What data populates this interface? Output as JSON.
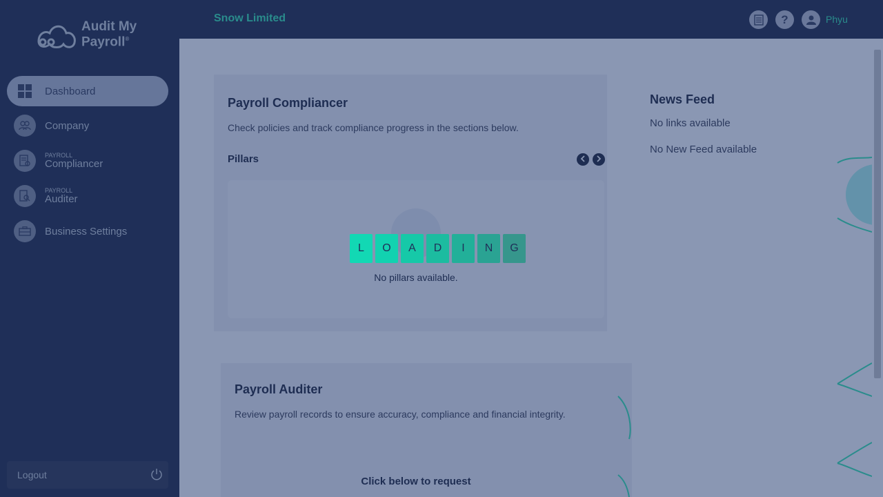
{
  "app": {
    "logo_line1": "Audit My",
    "logo_line2": "Payroll",
    "logo_mark": "®"
  },
  "sidebar": {
    "items": [
      {
        "label": "Dashboard",
        "icon": "dashboard-grid-icon",
        "active": true
      },
      {
        "label": "Company",
        "icon": "people-icon"
      },
      {
        "small": "PAYROLL",
        "label": "Compliancer",
        "icon": "compliance-document-icon"
      },
      {
        "small": "PAYROLL",
        "label": "Auditer",
        "icon": "audit-search-icon"
      },
      {
        "label": "Business Settings",
        "icon": "briefcase-icon"
      }
    ],
    "logout_label": "Logout"
  },
  "header": {
    "company": "Snow Limited",
    "user": "Phyu",
    "icons": [
      "report-icon",
      "help-icon",
      "user-avatar-icon"
    ],
    "help_glyph": "?"
  },
  "compliancer": {
    "title": "Payroll Compliancer",
    "subtitle": "Check policies and track compliance progress in the sections below.",
    "pillars_label": "Pillars",
    "empty_text": "No pillars available."
  },
  "news": {
    "title": "News Feed",
    "no_links": "No links available",
    "no_feed": "No New Feed available"
  },
  "auditer": {
    "title": "Payroll Auditer",
    "subtitle": "Review payroll records to ensure accuracy, compliance and financial integrity.",
    "request_text": "Click below to request"
  },
  "loading": {
    "letters": [
      "L",
      "O",
      "A",
      "D",
      "I",
      "N",
      "G"
    ],
    "colors": [
      "#12d8b4",
      "#12d2b0",
      "#16c9a8",
      "#1cbca0",
      "#22b099",
      "#2aa393",
      "#36968c"
    ]
  },
  "colors": {
    "sidebar_bg": "#1f2f58",
    "accent": "#2a8c8c",
    "overlay_bg": "#8a97b3"
  }
}
